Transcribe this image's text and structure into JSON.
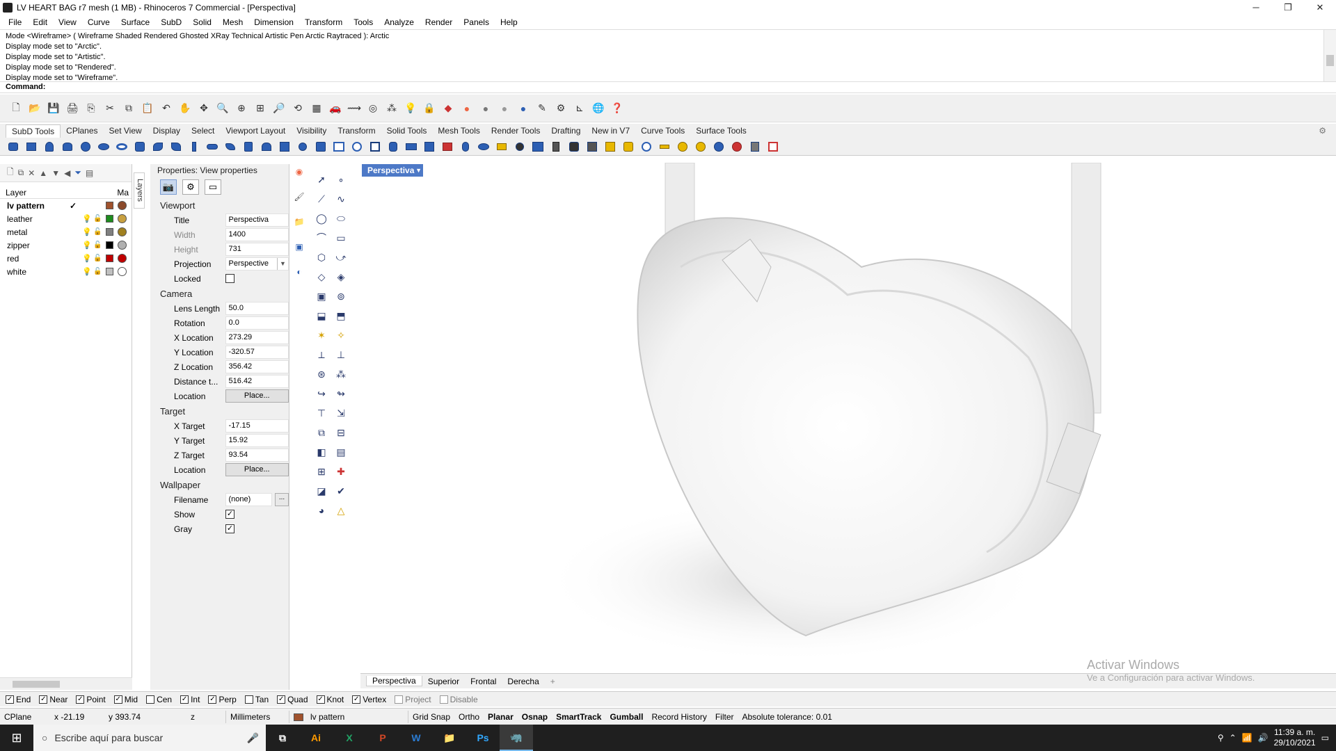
{
  "window": {
    "title": "LV HEART BAG r7 mesh (1 MB) - Rhinoceros 7 Commercial - [Perspectiva]",
    "minimize": "─",
    "restore": "❐",
    "close": "✕"
  },
  "menu": [
    "File",
    "Edit",
    "View",
    "Curve",
    "Surface",
    "SubD",
    "Solid",
    "Mesh",
    "Dimension",
    "Transform",
    "Tools",
    "Analyze",
    "Render",
    "Panels",
    "Help"
  ],
  "command_history": [
    "Mode <Wireframe> ( Wireframe Shaded Rendered Ghosted XRay Technical Artistic Pen Arctic Raytraced ): Arctic",
    "Display mode set to \"Arctic\".",
    "Display mode set to \"Artistic\".",
    "Display mode set to \"Rendered\".",
    "Display mode set to \"Wireframe\"."
  ],
  "command_prompt": "Command:",
  "toolbar_tabs": [
    "SubD Tools",
    "CPlanes",
    "Set View",
    "Display",
    "Select",
    "Viewport Layout",
    "Visibility",
    "Transform",
    "Solid Tools",
    "Mesh Tools",
    "Render Tools",
    "Drafting",
    "New in V7",
    "Curve Tools",
    "Surface Tools"
  ],
  "layers": {
    "header_layer": "Layer",
    "header_material": "Ma",
    "side_tab": "Layers",
    "rows": [
      {
        "name": "lv pattern",
        "current": "✓",
        "color": "#a0522d",
        "material": "#8b4a2b"
      },
      {
        "name": "leather",
        "color": "#1e8c1e",
        "material": "#c8a040"
      },
      {
        "name": "metal",
        "color": "#808080",
        "material": "#a08020"
      },
      {
        "name": "zipper",
        "color": "#000000",
        "material": "#b0b0b0"
      },
      {
        "name": "red",
        "color": "#c00000",
        "material": "#c00000"
      },
      {
        "name": "white",
        "color": "#c0c0c0",
        "material": "#ffffff"
      }
    ]
  },
  "properties": {
    "title": "Properties: View properties",
    "viewport_section": "Viewport",
    "title_label": "Title",
    "title_value": "Perspectiva",
    "width_label": "Width",
    "width_value": "1400",
    "height_label": "Height",
    "height_value": "731",
    "projection_label": "Projection",
    "projection_value": "Perspective",
    "locked_label": "Locked",
    "camera_section": "Camera",
    "lens_label": "Lens Length",
    "lens_value": "50.0",
    "rotation_label": "Rotation",
    "rotation_value": "0.0",
    "xloc_label": "X Location",
    "xloc_value": "273.29",
    "yloc_label": "Y Location",
    "yloc_value": "-320.57",
    "zloc_label": "Z Location",
    "zloc_value": "356.42",
    "dist_label": "Distance t...",
    "dist_value": "516.42",
    "location_label": "Location",
    "place_button": "Place...",
    "target_section": "Target",
    "xtgt_label": "X Target",
    "xtgt_value": "-17.15",
    "ytgt_label": "Y Target",
    "ytgt_value": "15.92",
    "ztgt_label": "Z Target",
    "ztgt_value": "93.54",
    "wallpaper_section": "Wallpaper",
    "filename_label": "Filename",
    "filename_value": "(none)",
    "browse_button": "...",
    "show_label": "Show",
    "show_checked": "✓",
    "gray_label": "Gray",
    "gray_checked": "✓"
  },
  "viewport": {
    "label": "Perspectiva",
    "tabs": [
      "Perspectiva",
      "Superior",
      "Frontal",
      "Derecha"
    ],
    "add_tab": "+"
  },
  "watermark": {
    "line1": "Activar Windows",
    "line2": "Ve a Configuración para activar Windows."
  },
  "osnaps": [
    {
      "label": "End",
      "checked": "✓"
    },
    {
      "label": "Near",
      "checked": "✓"
    },
    {
      "label": "Point",
      "checked": "✓"
    },
    {
      "label": "Mid",
      "checked": "✓"
    },
    {
      "label": "Cen",
      "checked": ""
    },
    {
      "label": "Int",
      "checked": "✓"
    },
    {
      "label": "Perp",
      "checked": "✓"
    },
    {
      "label": "Tan",
      "checked": ""
    },
    {
      "label": "Quad",
      "checked": "✓"
    },
    {
      "label": "Knot",
      "checked": "✓"
    },
    {
      "label": "Vertex",
      "checked": "✓"
    },
    {
      "label": "Project",
      "checked": ""
    },
    {
      "label": "Disable",
      "checked": ""
    }
  ],
  "status": {
    "cplane": "CPlane",
    "x": "x -21.19",
    "y": "y 393.74",
    "z": "z",
    "units": "Millimeters",
    "layer": "lv pattern",
    "grid_snap": "Grid Snap",
    "ortho": "Ortho",
    "planar": "Planar",
    "osnap": "Osnap",
    "smarttrack": "SmartTrack",
    "gumball": "Gumball",
    "record_history": "Record History",
    "filter": "Filter",
    "tolerance": "Absolute tolerance: 0.01"
  },
  "taskbar": {
    "search_placeholder": "Escribe aquí para buscar",
    "apps": [
      "Ai",
      "X",
      "P",
      "W",
      "📁",
      "Ps",
      "🦏"
    ],
    "time": "11:39 a. m.",
    "date": "29/10/2021"
  }
}
